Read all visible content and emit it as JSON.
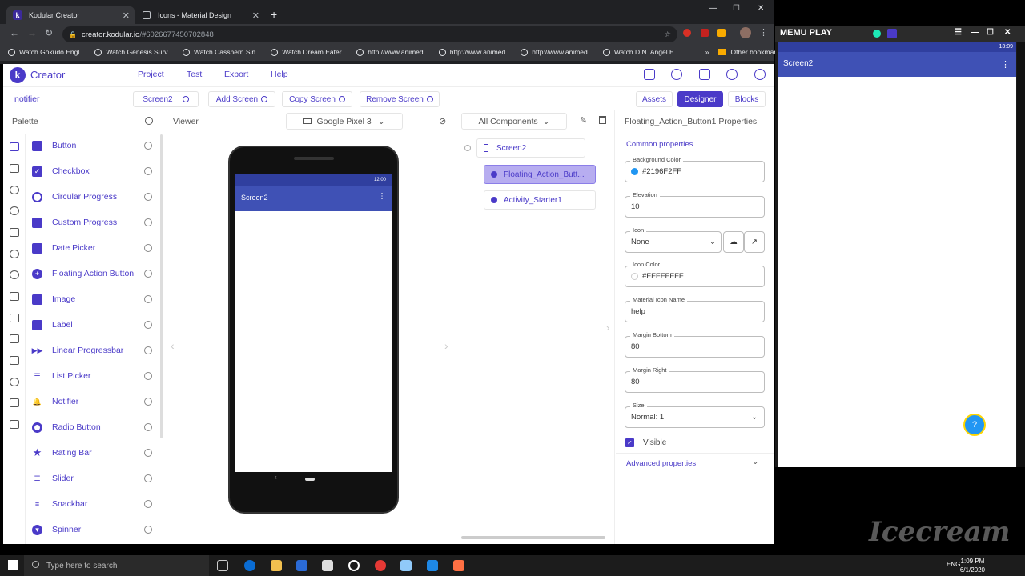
{
  "browser": {
    "tabs": [
      {
        "title": "Kodular Creator",
        "close": "✕"
      },
      {
        "title": "Icons - Material Design",
        "close": "✕"
      }
    ],
    "new_tab": "+",
    "window_controls": [
      "—",
      "☐",
      "✕"
    ],
    "url_host": "creator.kodular.io",
    "url_path": "/#6026677450702848",
    "bookmarks": [
      "Watch Gokudo Engl...",
      "Watch Genesis Surv...",
      "Watch Casshern Sin...",
      "Watch Dream Eater...",
      "http://www.animed...",
      "http://www.animed...",
      "http://www.animed...",
      "Watch D.N. Angel E..."
    ],
    "bookmarks_more": "»",
    "other_bookmarks": "Other bookmarks"
  },
  "app": {
    "brand_letter": "k",
    "brand": "Creator",
    "menu": [
      "Project",
      "Test",
      "Export",
      "Help"
    ],
    "project_name": "notifier",
    "screen_select": "Screen2",
    "add_screen": "Add Screen",
    "copy_screen": "Copy Screen",
    "remove_screen": "Remove Screen",
    "tabs": {
      "assets": "Assets",
      "designer": "Designer",
      "blocks": "Blocks"
    },
    "accent": "#4a3ac8"
  },
  "palette": {
    "title": "Palette",
    "items": [
      "Button",
      "Checkbox",
      "Circular Progress",
      "Custom Progress",
      "Date Picker",
      "Floating Action Button",
      "Image",
      "Label",
      "Linear Progressbar",
      "List Picker",
      "Notifier",
      "Radio Button",
      "Rating Bar",
      "Slider",
      "Snackbar",
      "Spinner"
    ]
  },
  "viewer": {
    "title": "Viewer",
    "device": "Google Pixel 3",
    "status_time": "12:00",
    "screen_title": "Screen2",
    "overflow": "⋮",
    "prev": "‹",
    "next": "›"
  },
  "components": {
    "filter": "All Components",
    "nodes": [
      "Screen2",
      "Floating_Action_Butt...",
      "Activity_Starter1"
    ]
  },
  "properties": {
    "title": "Floating_Action_Button1 Properties",
    "section": "Common properties",
    "fields": {
      "background_color": {
        "label": "Background Color",
        "value": "#2196F2FF",
        "color": "#2196f2"
      },
      "elevation": {
        "label": "Elevation",
        "value": "10"
      },
      "icon": {
        "label": "Icon",
        "value": "None"
      },
      "icon_color": {
        "label": "Icon Color",
        "value": "#FFFFFFFF",
        "color": "#ffffff"
      },
      "material_icon_name": {
        "label": "Material Icon Name",
        "value": "help"
      },
      "margin_bottom": {
        "label": "Margin Bottom",
        "value": "80"
      },
      "margin_right": {
        "label": "Margin Right",
        "value": "80"
      },
      "size": {
        "label": "Size",
        "value": "Normal: 1"
      }
    },
    "visible_label": "Visible",
    "visible_checked": true,
    "advanced": "Advanced properties"
  },
  "emulator": {
    "brand": "MEMU PLAY",
    "status_time": "13:09",
    "screen_title": "Screen2",
    "overflow": "⋮",
    "fab_icon": "?",
    "fab_color": "#2196f3"
  },
  "taskbar": {
    "search_placeholder": "Type here to search",
    "language": "ENG",
    "time": "1:09 PM",
    "date": "6/1/2020"
  },
  "watermark": "Icecream"
}
